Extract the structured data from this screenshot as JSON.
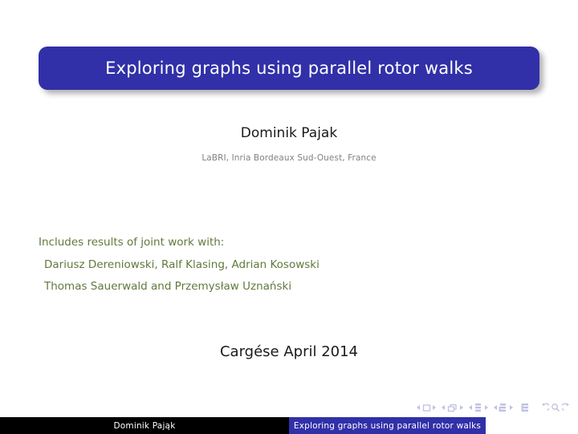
{
  "slide": {
    "title": "Exploring graphs using parallel rotor walks",
    "author": "Dominik Pajak",
    "institute": "LaBRI, Inria Bordeaux Sud-Ouest, France",
    "joint_work": [
      "Includes results of joint work with:",
      "Dariusz Dereniowski, Ralf Klasing, Adrian Kosowski",
      "Thomas Sauerwald and Przemysław Uznański"
    ],
    "date": "Cargése April 2014"
  },
  "footline": {
    "author": "Dominik Pająk",
    "title": "Exploring graphs using parallel rotor walks"
  },
  "navigation": {
    "items": [
      "slide-previous-icon",
      "slide-icon",
      "slide-next-icon",
      "frame-previous-icon",
      "frame-icon",
      "frame-next-icon",
      "subsection-previous-icon",
      "subsection-icon",
      "subsection-next-icon",
      "section-previous-icon",
      "section-icon",
      "section-next-icon",
      "document-icon",
      "go-back-icon",
      "search-icon",
      "go-forward-icon"
    ]
  },
  "colors": {
    "structure_blue": "#3130a8",
    "joint_work_green": "#5f7a3c",
    "institute_gray": "#828282",
    "footline_black": "#000000",
    "nav_symbol": "#bfc0e2"
  }
}
